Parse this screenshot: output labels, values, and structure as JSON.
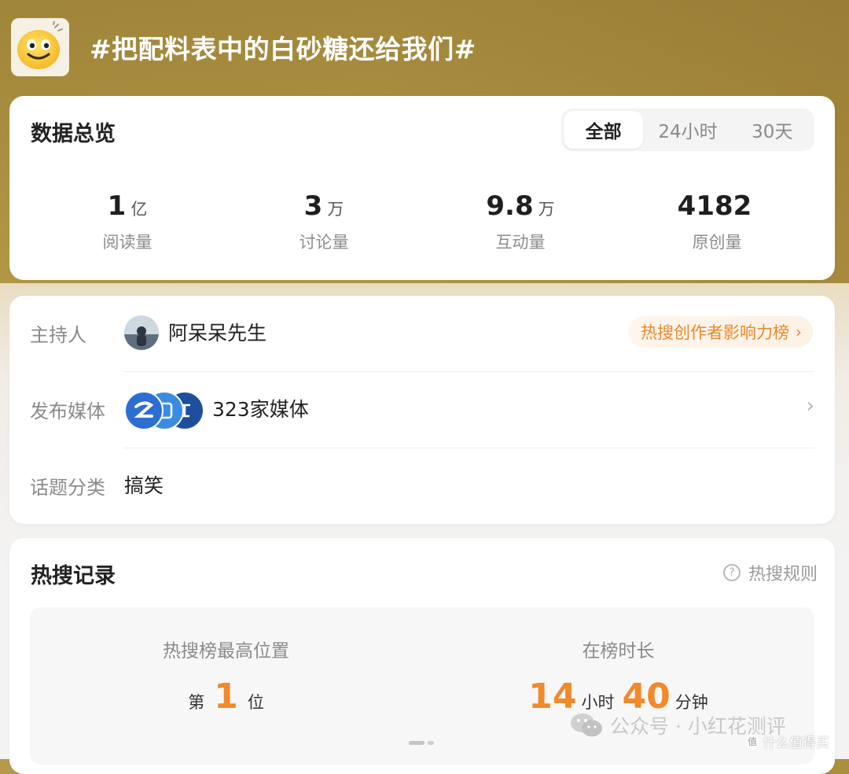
{
  "header": {
    "topic_title": "#把配料表中的白砂糖还给我们#"
  },
  "overview": {
    "title": "数据总览",
    "tabs": [
      {
        "label": "全部",
        "active": true
      },
      {
        "label": "24小时",
        "active": false
      },
      {
        "label": "30天",
        "active": false
      }
    ],
    "stats": [
      {
        "value": "1",
        "unit": "亿",
        "label": "阅读量"
      },
      {
        "value": "3",
        "unit": "万",
        "label": "讨论量"
      },
      {
        "value": "9.8",
        "unit": "万",
        "label": "互动量"
      },
      {
        "value": "4182",
        "unit": "",
        "label": "原创量"
      }
    ]
  },
  "info": {
    "host_label": "主持人",
    "host_name": "阿呆呆先生",
    "rank_badge": "热搜创作者影响力榜",
    "media_label": "发布媒体",
    "media_count": "323家媒体",
    "category_label": "话题分类",
    "category_value": "搞笑"
  },
  "hot": {
    "title": "热搜记录",
    "rules_label": "热搜规则",
    "peak_label": "热搜榜最高位置",
    "peak_prefix": "第",
    "peak_value": "1",
    "peak_suffix": "位",
    "duration_label": "在榜时长",
    "duration_hours": "14",
    "duration_hours_unit": "小时",
    "duration_minutes": "40",
    "duration_minutes_unit": "分钟"
  },
  "watermark": {
    "text": "公众号 · 小红花测评",
    "site_text": "什么值得买"
  },
  "colors": {
    "accent_orange": "#f2892a",
    "badge_orange": "#e8892a",
    "header_gold": "#b59a48"
  },
  "icons": {
    "avatar": "smiling-emoji-icon",
    "rules": "question-circle-icon",
    "chevron": "chevron-right-icon",
    "watermark": "wechat-icon"
  }
}
